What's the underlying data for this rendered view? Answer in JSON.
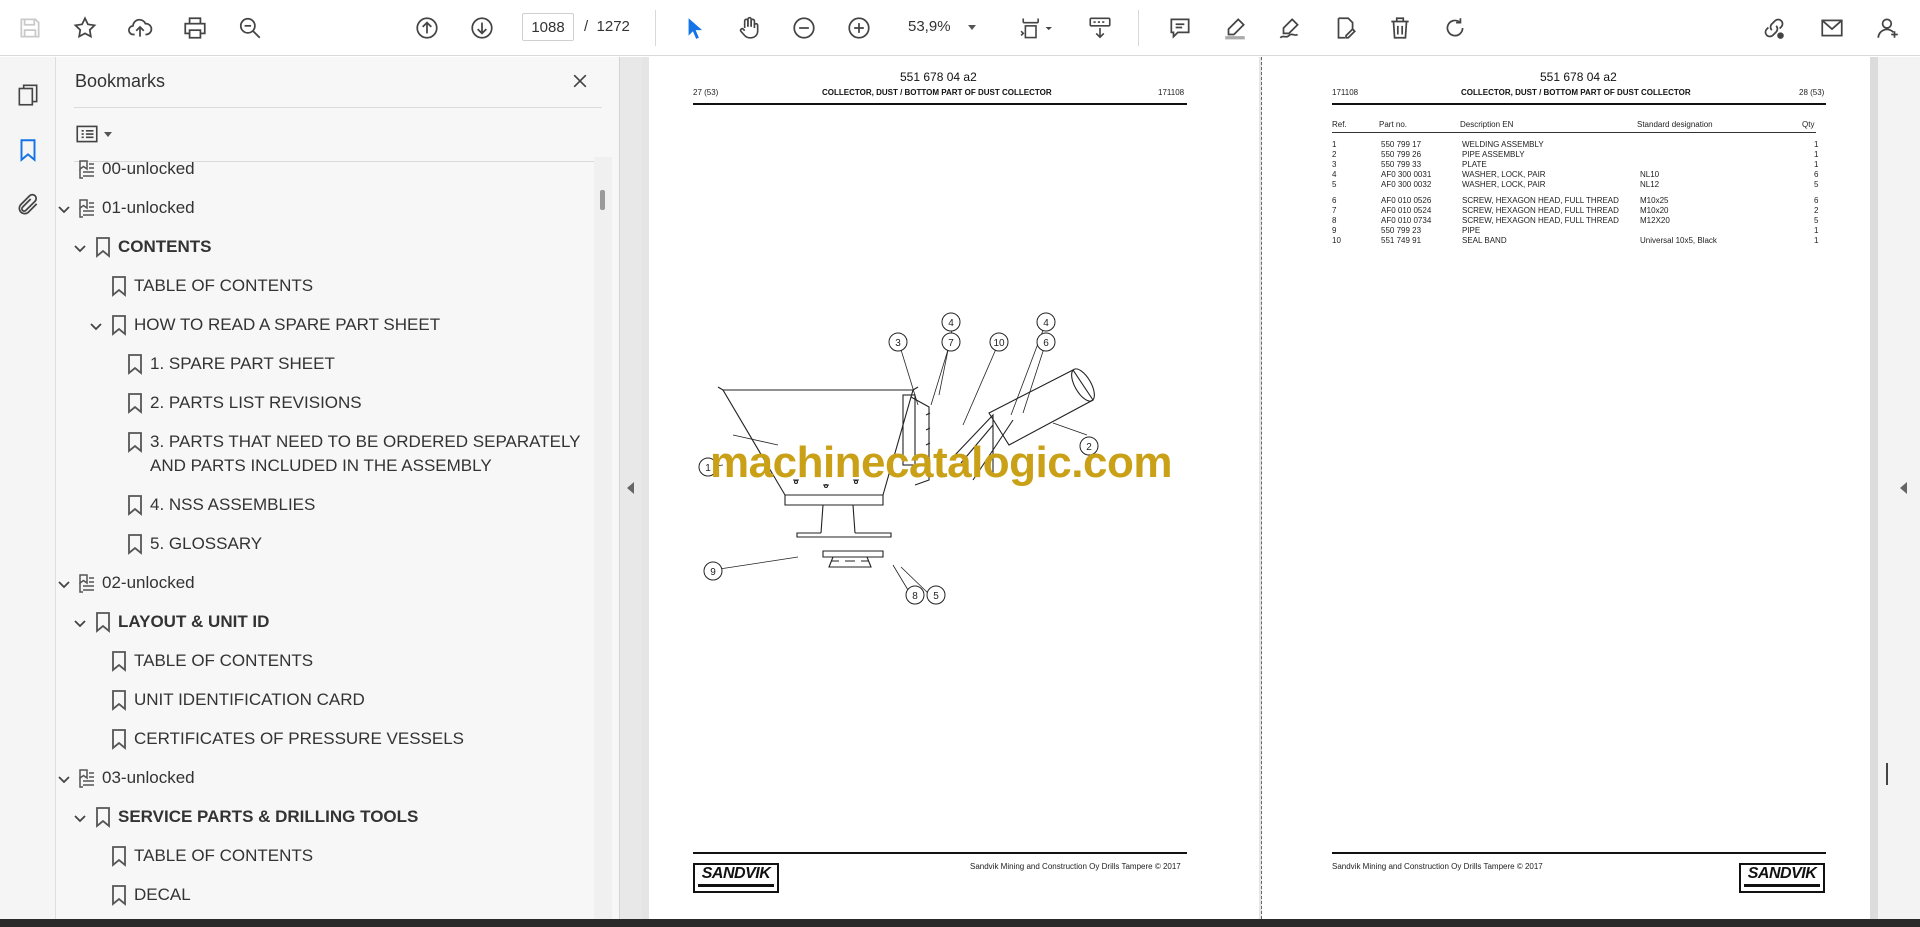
{
  "toolbar": {
    "page_current": "1088",
    "page_separator": "/",
    "page_total": "1272",
    "zoom": "53,9%"
  },
  "panel": {
    "title": "Bookmarks"
  },
  "bookmarks": [
    {
      "label": "00-unlocked",
      "level": 0,
      "expanded": null,
      "icon": "multi-bookmark-icon",
      "bold": false
    },
    {
      "label": "01-unlocked",
      "level": 0,
      "expanded": true,
      "icon": "multi-bookmark-icon",
      "bold": false
    },
    {
      "label": "CONTENTS",
      "level": 1,
      "expanded": true,
      "icon": "bookmark-icon",
      "bold": true
    },
    {
      "label": "TABLE OF CONTENTS",
      "level": 2,
      "expanded": null,
      "icon": "bookmark-icon",
      "bold": false
    },
    {
      "label": "HOW TO READ A SPARE PART SHEET",
      "level": 2,
      "expanded": true,
      "icon": "bookmark-icon",
      "bold": false
    },
    {
      "label": "1. SPARE PART SHEET",
      "level": 3,
      "expanded": null,
      "icon": "bookmark-icon",
      "bold": false
    },
    {
      "label": "2. PARTS LIST REVISIONS",
      "level": 3,
      "expanded": null,
      "icon": "bookmark-icon",
      "bold": false
    },
    {
      "label": "3. PARTS THAT NEED TO BE ORDERED SEPARATELY",
      "label2": "AND PARTS INCLUDED IN THE ASSEMBLY",
      "level": 3,
      "expanded": null,
      "icon": "bookmark-icon",
      "bold": false
    },
    {
      "label": "4. NSS ASSEMBLIES",
      "level": 3,
      "expanded": null,
      "icon": "bookmark-icon",
      "bold": false
    },
    {
      "label": "5. GLOSSARY",
      "level": 3,
      "expanded": null,
      "icon": "bookmark-icon",
      "bold": false
    },
    {
      "label": "02-unlocked",
      "level": 0,
      "expanded": true,
      "icon": "multi-bookmark-icon",
      "bold": false
    },
    {
      "label": "LAYOUT & UNIT ID",
      "level": 1,
      "expanded": true,
      "icon": "bookmark-icon",
      "bold": true
    },
    {
      "label": "TABLE OF CONTENTS",
      "level": 2,
      "expanded": null,
      "icon": "bookmark-icon",
      "bold": false
    },
    {
      "label": "UNIT IDENTIFICATION CARD",
      "level": 2,
      "expanded": null,
      "icon": "bookmark-icon",
      "bold": false
    },
    {
      "label": "CERTIFICATES OF PRESSURE VESSELS",
      "level": 2,
      "expanded": null,
      "icon": "bookmark-icon",
      "bold": false
    },
    {
      "label": "03-unlocked",
      "level": 0,
      "expanded": true,
      "icon": "multi-bookmark-icon",
      "bold": false
    },
    {
      "label": "SERVICE PARTS & DRILLING TOOLS",
      "level": 1,
      "expanded": true,
      "icon": "bookmark-icon",
      "bold": true
    },
    {
      "label": "TABLE OF CONTENTS",
      "level": 2,
      "expanded": null,
      "icon": "bookmark-icon",
      "bold": false
    },
    {
      "label": "DECAL",
      "level": 2,
      "expanded": null,
      "icon": "bookmark-icon",
      "bold": false
    }
  ],
  "left_page": {
    "doc_number": "551 678 04 a2",
    "page_ref": "27 (53)",
    "title": "COLLECTOR, DUST / BOTTOM PART OF DUST COLLECTOR",
    "date_code": "171108",
    "footer_text": "Sandvik Mining and Construction Oy Drills Tampere © 2017",
    "logo_text": "SANDVIK",
    "callouts": [
      "1",
      "2",
      "3",
      "4",
      "4",
      "5",
      "6",
      "7",
      "8",
      "9",
      "10"
    ]
  },
  "right_page": {
    "doc_number": "551 678 04 a2",
    "date_code": "171108",
    "title": "COLLECTOR, DUST / BOTTOM PART OF DUST COLLECTOR",
    "page_ref": "28 (53)",
    "footer_text": "Sandvik Mining and Construction Oy Drills Tampere © 2017",
    "logo_text": "SANDVIK",
    "table": {
      "headers": [
        "Ref.",
        "Part no.",
        "Description EN",
        "Standard designation",
        "Qty"
      ],
      "rows": [
        [
          "1",
          "550 799 17",
          "WELDING ASSEMBLY",
          "",
          "1"
        ],
        [
          "2",
          "550 799 26",
          "PIPE ASSEMBLY",
          "",
          "1"
        ],
        [
          "3",
          "550 799 33",
          "PLATE",
          "",
          "1"
        ],
        [
          "4",
          "AF0 300 0031",
          "WASHER, LOCK, PAIR",
          "NL10",
          "6"
        ],
        [
          "5",
          "AF0 300 0032",
          "WASHER, LOCK, PAIR",
          "NL12",
          "5"
        ],
        [
          "6",
          "AF0 010 0526",
          "SCREW, HEXAGON HEAD, FULL THREAD",
          "M10x25",
          "6"
        ],
        [
          "7",
          "AF0 010 0524",
          "SCREW, HEXAGON HEAD, FULL THREAD",
          "M10x20",
          "2"
        ],
        [
          "8",
          "AF0 010 0734",
          "SCREW, HEXAGON HEAD, FULL THREAD",
          "M12X20",
          "5"
        ],
        [
          "9",
          "550 799 23",
          "PIPE",
          "",
          "1"
        ],
        [
          "10",
          "551 749 91",
          "SEAL BAND",
          "Universal 10x5, Black",
          "1"
        ]
      ]
    }
  },
  "watermark": "machinecatalogic.com"
}
